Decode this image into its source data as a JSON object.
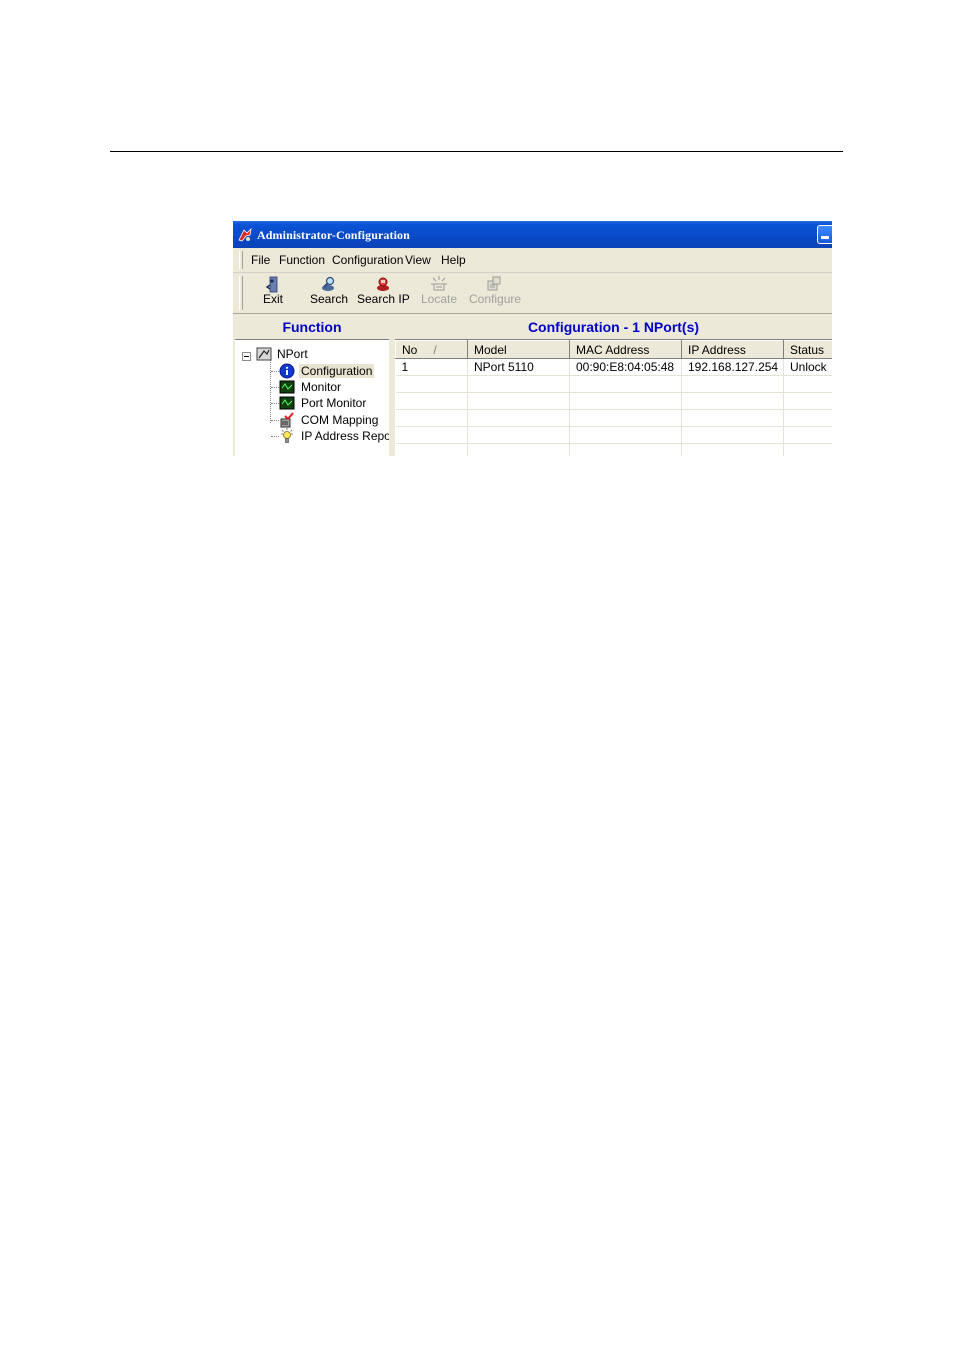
{
  "window": {
    "title": "Administrator-Configuration"
  },
  "menu": {
    "items": [
      {
        "label": "File"
      },
      {
        "label": "Function"
      },
      {
        "label": "Configuration"
      },
      {
        "label": "View"
      },
      {
        "label": "Help"
      }
    ]
  },
  "toolbar": {
    "buttons": [
      {
        "label": "Exit",
        "icon": "exit-icon",
        "enabled": true
      },
      {
        "label": "Search",
        "icon": "search-icon",
        "enabled": true
      },
      {
        "label": "Search IP",
        "icon": "search-ip-icon",
        "enabled": true
      },
      {
        "label": "Locate",
        "icon": "locate-icon",
        "enabled": false
      },
      {
        "label": "Configure",
        "icon": "configure-icon",
        "enabled": false
      }
    ]
  },
  "function_pane": {
    "title": "Function",
    "tree": {
      "root": {
        "label": "NPort",
        "icon": "nport-icon"
      },
      "children": [
        {
          "label": "Configuration",
          "icon": "info-icon",
          "selected": true
        },
        {
          "label": "Monitor",
          "icon": "monitor-icon"
        },
        {
          "label": "Port Monitor",
          "icon": "port-monitor-icon"
        },
        {
          "label": "COM Mapping",
          "icon": "com-mapping-icon"
        },
        {
          "label": "IP Address Report",
          "icon": "lightbulb-icon"
        }
      ]
    }
  },
  "config_pane": {
    "title": "Configuration - 1 NPort(s)",
    "columns": [
      "No",
      "Model",
      "MAC Address",
      "IP Address",
      "Status"
    ],
    "sort_indicator": "/",
    "rows": [
      {
        "no": "1",
        "model": "NPort 5110",
        "mac": "00:90:E8:04:05:48",
        "ip": "192.168.127.254",
        "status": "Unlock"
      }
    ]
  },
  "colors": {
    "titlebar": "#0a54d6",
    "pane_header_text": "#0000c8",
    "face": "#ece9d8"
  }
}
